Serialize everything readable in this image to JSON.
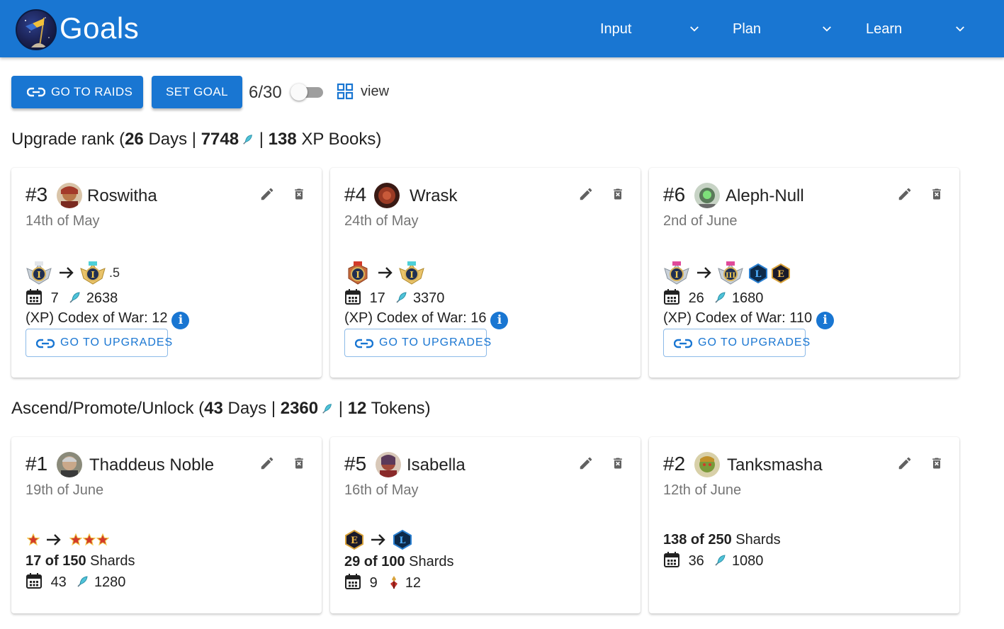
{
  "app": {
    "title": "Goals"
  },
  "nav": [
    {
      "label": "Input"
    },
    {
      "label": "Plan"
    },
    {
      "label": "Learn"
    }
  ],
  "toolbar": {
    "raids_label": "GO TO RAIDS",
    "set_goal_label": "SET GOAL",
    "goal_count": "6/30",
    "view_label": "view",
    "toggle_on": false
  },
  "colors": {
    "primary": "#1976d2",
    "header": "#1976d2"
  },
  "upgrade_section": {
    "prefix": "Upgrade rank (",
    "days": "26",
    "days_suffix": " Days | ",
    "gold": "7748",
    "sep": " | ",
    "books": "138",
    "books_suffix": " XP Books)"
  },
  "ascend_section": {
    "prefix": "Ascend/Promote/Unlock (",
    "days": "43",
    "days_suffix": " Days | ",
    "gold": "2360",
    "sep": " | ",
    "tokens": "12",
    "tokens_suffix": " Tokens)"
  },
  "upgrade_cards": [
    {
      "num": "#3",
      "name": "Roswitha",
      "date": "14th of May",
      "rank_suffix": ".5",
      "days": "7",
      "gold": "2638",
      "codex": "(XP) Codex of War: 12",
      "button": "GO TO UPGRADES"
    },
    {
      "num": "#4",
      "name": "Wrask",
      "date": "24th of May",
      "rank_suffix": "",
      "days": "17",
      "gold": "3370",
      "codex": "(XP) Codex of War: 16",
      "button": "GO TO UPGRADES"
    },
    {
      "num": "#6",
      "name": "Aleph-Null",
      "date": "2nd of June",
      "rank_suffix": "",
      "days": "26",
      "gold": "1680",
      "codex": "(XP) Codex of War: 110",
      "button": "GO TO UPGRADES"
    }
  ],
  "ascend_cards": [
    {
      "num": "#1",
      "name": "Thaddeus Noble",
      "date": "19th of June",
      "shards_have": "17 of 150",
      "shards_label": "Shards",
      "days": "43",
      "gold": "1280"
    },
    {
      "num": "#5",
      "name": "Isabella",
      "date": "16th of May",
      "shards_have": "29 of 100",
      "shards_label": "Shards",
      "days": "9",
      "tokens": "12"
    },
    {
      "num": "#2",
      "name": "Tanksmasha",
      "date": "12th of June",
      "shards_have": "138 of 250",
      "shards_label": "Shards",
      "days": "36",
      "gold": "1080"
    }
  ],
  "icons": {
    "edit": "pencil-icon",
    "delete": "trash-icon",
    "calendar": "calendar-icon",
    "gold": "feather-icon",
    "info": "info-icon",
    "link": "link-icon",
    "arrow": "arrow-right-icon",
    "view": "grid-view-icon",
    "token": "token-icon"
  }
}
